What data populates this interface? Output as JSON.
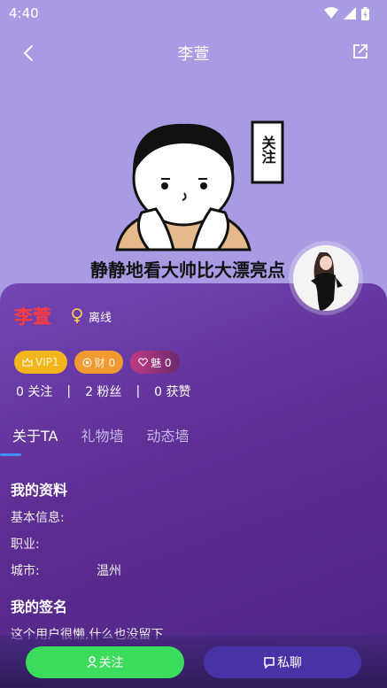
{
  "status_bar": {
    "time": "4:40"
  },
  "header": {
    "title": "李萱"
  },
  "banner": {
    "meme_text": "静静地看大帅比大漂亮点",
    "sign_text": "关注"
  },
  "profile": {
    "name": "李萱",
    "online_status": "离线",
    "badges": [
      {
        "label": "VIP1",
        "icon": "crown-icon"
      },
      {
        "label": "财 0",
        "icon": "coin-icon"
      },
      {
        "label": "魅 0",
        "icon": "heart-icon"
      }
    ],
    "stats": {
      "following": "0 关注",
      "fans": "2 粉丝",
      "likes": "0 获赞",
      "sep": "|"
    }
  },
  "tabs": [
    "关于TA",
    "礼物墙",
    "动态墙"
  ],
  "about": {
    "section_title": "我的资料",
    "rows": [
      {
        "label": "基本信息:",
        "value": ""
      },
      {
        "label": "职业:",
        "value": ""
      },
      {
        "label": "城市:",
        "value": "温州"
      }
    ],
    "signature_title": "我的签名",
    "signature": "这个用户很懒,什么也没留下"
  },
  "actions": {
    "follow": "关注",
    "chat": "私聊"
  },
  "colors": {
    "accent_name": "#ff3b3b",
    "follow_green": "#3cdc5c",
    "chat_purple": "#4733a6",
    "card_purple": "#5d2d92"
  }
}
